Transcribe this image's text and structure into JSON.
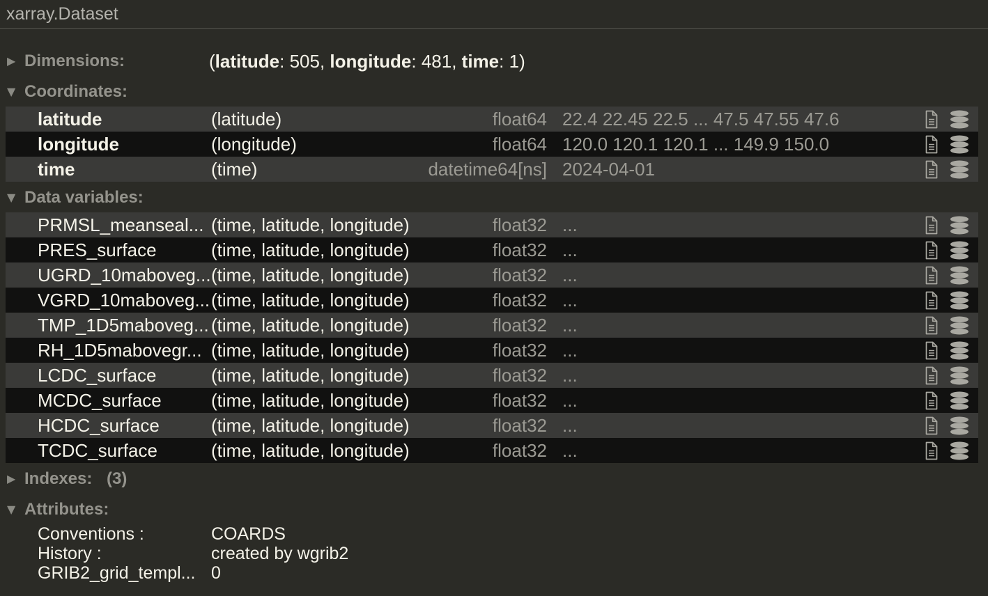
{
  "title": "xarray.Dataset",
  "colors": {
    "background": "#2b2b26",
    "row_light": "#3a3a38",
    "row_dark": "#111110",
    "divider": "#55544e",
    "text_bright": "#f4f2e8",
    "text_title": "#b4b3ad",
    "text_section": "#94938c",
    "text_muted": "#9b9a93",
    "arrow": "#8a8a83",
    "icon": "#a9a8a1"
  },
  "icons": {
    "collapsed_arrow": "chevron-right-icon",
    "expanded_arrow": "chevron-down-icon",
    "attrs_toggle": "document-icon",
    "data_toggle": "database-icon"
  },
  "sections": {
    "dimensions": {
      "label": "Dimensions:",
      "state": "collapsed",
      "dims": [
        {
          "name": "latitude",
          "size": "505"
        },
        {
          "name": "longitude",
          "size": "481"
        },
        {
          "name": "time",
          "size": "1"
        }
      ]
    },
    "coordinates": {
      "label": "Coordinates:",
      "state": "expanded",
      "rows": [
        {
          "name": "latitude",
          "dims": "(latitude)",
          "dtype": "float64",
          "preview": "22.4 22.45 22.5 ... 47.5 47.55 47.6"
        },
        {
          "name": "longitude",
          "dims": "(longitude)",
          "dtype": "float64",
          "preview": "120.0 120.1 120.1 ... 149.9 150.0"
        },
        {
          "name": "time",
          "dims": "(time)",
          "dtype": "datetime64[ns]",
          "preview": "2024-04-01"
        }
      ]
    },
    "data_variables": {
      "label": "Data variables:",
      "state": "expanded",
      "rows": [
        {
          "name": "PRMSL_meanseal...",
          "dims": "(time, latitude, longitude)",
          "dtype": "float32",
          "preview": "..."
        },
        {
          "name": "PRES_surface",
          "dims": "(time, latitude, longitude)",
          "dtype": "float32",
          "preview": "..."
        },
        {
          "name": "UGRD_10maboveg...",
          "dims": "(time, latitude, longitude)",
          "dtype": "float32",
          "preview": "..."
        },
        {
          "name": "VGRD_10maboveg...",
          "dims": "(time, latitude, longitude)",
          "dtype": "float32",
          "preview": "..."
        },
        {
          "name": "TMP_1D5maboveg...",
          "dims": "(time, latitude, longitude)",
          "dtype": "float32",
          "preview": "..."
        },
        {
          "name": "RH_1D5mabovegr...",
          "dims": "(time, latitude, longitude)",
          "dtype": "float32",
          "preview": "..."
        },
        {
          "name": "LCDC_surface",
          "dims": "(time, latitude, longitude)",
          "dtype": "float32",
          "preview": "..."
        },
        {
          "name": "MCDC_surface",
          "dims": "(time, latitude, longitude)",
          "dtype": "float32",
          "preview": "..."
        },
        {
          "name": "HCDC_surface",
          "dims": "(time, latitude, longitude)",
          "dtype": "float32",
          "preview": "..."
        },
        {
          "name": "TCDC_surface",
          "dims": "(time, latitude, longitude)",
          "dtype": "float32",
          "preview": "..."
        }
      ]
    },
    "indexes": {
      "label": "Indexes:",
      "state": "collapsed",
      "count": "(3)"
    },
    "attributes": {
      "label": "Attributes:",
      "state": "expanded",
      "items": [
        {
          "key": "Conventions :",
          "value": "COARDS"
        },
        {
          "key": "History :",
          "value": "created by wgrib2"
        },
        {
          "key": "GRIB2_grid_templ...",
          "value": "0"
        }
      ]
    }
  }
}
